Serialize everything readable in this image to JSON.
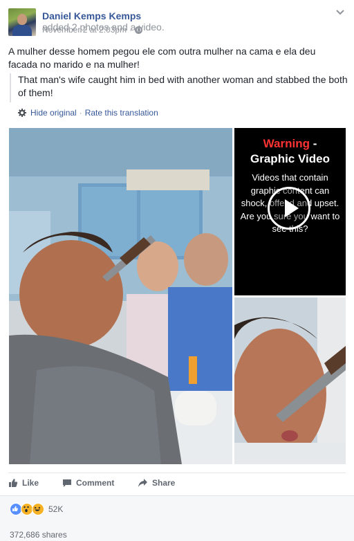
{
  "author": {
    "name": "Daniel Kemps Kemps",
    "action": "added 2 photos and a video."
  },
  "timestamp": "November 2 at 2:03pm",
  "meta_separator": "·",
  "post_text": "A mulher desse homem pegou ele com outra mulher na cama e ela deu facada no marido e na mulher!",
  "translation": {
    "text": "That man's wife caught him in bed with another woman and stabbed the both of them!",
    "hide_label": "Hide original",
    "separator": "·",
    "rate_label": "Rate this translation"
  },
  "video": {
    "warning_word": "Warning",
    "warning_dash": " -",
    "warning_subtitle": "Graphic Video",
    "warning_body": "Videos that contain graphic content can shock, offend and upset. Are you sure you want to see this?"
  },
  "actions": {
    "like": "Like",
    "comment": "Comment",
    "share": "Share"
  },
  "reactions": {
    "count": "52K",
    "types": [
      "like",
      "wow",
      "haha"
    ]
  },
  "shares": "372,686 shares",
  "colors": {
    "link": "#365899",
    "muted": "#90949c",
    "warning_red": "#ff3333",
    "like_blue": "#5890ff",
    "reaction_yellow": "#f7b125"
  }
}
